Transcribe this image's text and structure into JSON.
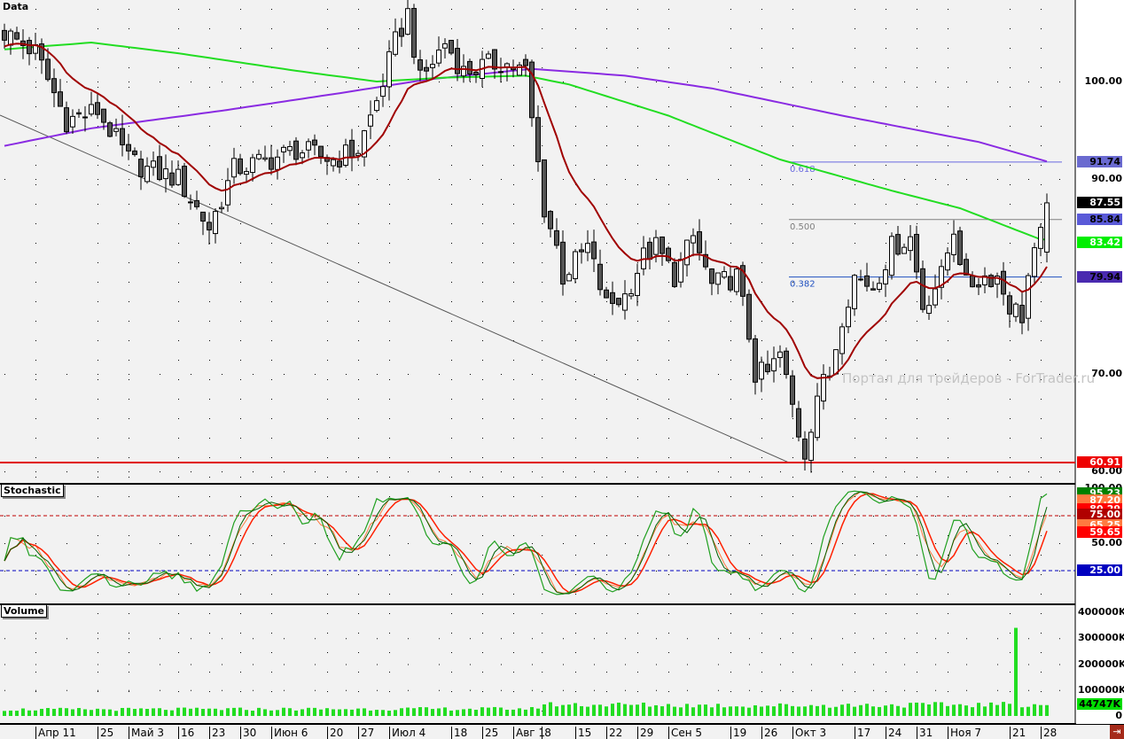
{
  "symbol_label": "Data",
  "panels": {
    "stochastic": "Stochastic",
    "volume": "Volume"
  },
  "watermark": "Портал для трейдеров - ForTrader.ru",
  "price_axis": {
    "min": 58,
    "max": 108,
    "ticks": [
      "100.00",
      "90.00",
      "70.00",
      "60.00"
    ],
    "tick_values": [
      100,
      90,
      70,
      60
    ]
  },
  "price_tags": [
    {
      "label": "91.74",
      "value": 91.74,
      "bg": "#6a6ad0",
      "fg": "#000"
    },
    {
      "label": "87.55",
      "value": 87.55,
      "bg": "#000000",
      "fg": "#fff"
    },
    {
      "label": "85.84",
      "value": 85.84,
      "bg": "#5a5ad8",
      "fg": "#000"
    },
    {
      "label": "83.42",
      "value": 83.42,
      "bg": "#00ee00",
      "fg": "#fff"
    },
    {
      "label": "79.94",
      "value": 79.94,
      "bg": "#4a2ab0",
      "fg": "#000"
    },
    {
      "label": "60.91",
      "value": 60.91,
      "bg": "#ee0000",
      "fg": "#fff"
    }
  ],
  "fibonacci": [
    {
      "label": "0.618",
      "value": 91.74,
      "color": "#6a6ae0"
    },
    {
      "label": "0.500",
      "value": 85.84,
      "color": "#808080"
    },
    {
      "label": "0.382",
      "value": 79.94,
      "color": "#2050c0"
    }
  ],
  "support_level": 60.91,
  "stoch_axis": {
    "ticks": [
      "100.00",
      "50.00"
    ],
    "tick_values": [
      100,
      50
    ]
  },
  "stoch_tags": [
    {
      "label": "95.23",
      "value": 95.23,
      "bg": "#008000",
      "fg": "#fff"
    },
    {
      "label": "87.20",
      "value": 88.5,
      "bg": "#ff7a40",
      "fg": "#fff"
    },
    {
      "label": "80.29",
      "value": 80.29,
      "bg": "#ff0000",
      "fg": "#fff"
    },
    {
      "label": "75.00",
      "value": 75.5,
      "bg": "#b00000",
      "fg": "#fff"
    },
    {
      "label": "65.25",
      "value": 65.8,
      "bg": "#ff7a40",
      "fg": "#fff"
    },
    {
      "label": "59.65",
      "value": 59.65,
      "bg": "#ff0000",
      "fg": "#fff"
    },
    {
      "label": "25.00",
      "value": 25,
      "bg": "#0000c0",
      "fg": "#fff"
    }
  ],
  "volume_axis": {
    "ticks": [
      "400000K",
      "300000K",
      "200000K",
      "100000K",
      "0"
    ],
    "tick_values": [
      400000,
      300000,
      200000,
      100000,
      0
    ]
  },
  "volume_tag": {
    "label": "44747K",
    "value": 44747,
    "bg": "#00dd00",
    "fg": "#000"
  },
  "dates": [
    {
      "label": "Апр 11",
      "day": 5
    },
    {
      "label": "25",
      "day": 15
    },
    {
      "label": "Май 3",
      "day": 20
    },
    {
      "label": "16",
      "day": 28
    },
    {
      "label": "23",
      "day": 33
    },
    {
      "label": "30",
      "day": 38
    },
    {
      "label": "Июн 6",
      "day": 43
    },
    {
      "label": "20",
      "day": 52
    },
    {
      "label": "27",
      "day": 57
    },
    {
      "label": "Июл 4",
      "day": 62
    },
    {
      "label": "18",
      "day": 72
    },
    {
      "label": "25",
      "day": 77
    },
    {
      "label": "Авг 1",
      "day": 82
    },
    {
      "label": "8",
      "day": 86.6
    },
    {
      "label": "15",
      "day": 92
    },
    {
      "label": "22",
      "day": 97
    },
    {
      "label": "29",
      "day": 102
    },
    {
      "label": "Сен 5",
      "day": 107
    },
    {
      "label": "19",
      "day": 117
    },
    {
      "label": "26",
      "day": 122
    },
    {
      "label": "Окт 3",
      "day": 127
    },
    {
      "label": "17",
      "day": 137
    },
    {
      "label": "24",
      "day": 142
    },
    {
      "label": "31",
      "day": 147
    },
    {
      "label": "Ноя 7",
      "day": 152
    },
    {
      "label": "21",
      "day": 162
    },
    {
      "label": "28",
      "day": 167
    }
  ],
  "chart_data": {
    "type": "candlestick",
    "bars": 169,
    "close_path": [
      [
        0,
        105
      ],
      [
        5,
        103
      ],
      [
        10,
        96
      ],
      [
        15,
        97
      ],
      [
        20,
        92
      ],
      [
        23,
        91
      ],
      [
        28,
        90
      ],
      [
        33,
        85
      ],
      [
        37,
        91
      ],
      [
        43,
        92
      ],
      [
        47,
        93
      ],
      [
        53,
        92
      ],
      [
        57,
        93
      ],
      [
        60,
        98
      ],
      [
        63,
        104
      ],
      [
        65,
        107
      ],
      [
        67,
        100
      ],
      [
        71,
        104
      ],
      [
        74,
        101
      ],
      [
        80,
        102
      ],
      [
        84,
        101
      ],
      [
        85,
        96
      ],
      [
        87,
        87
      ],
      [
        89,
        83
      ],
      [
        90,
        80
      ],
      [
        94,
        83
      ],
      [
        97,
        77
      ],
      [
        100,
        78
      ],
      [
        103,
        82
      ],
      [
        105,
        83
      ],
      [
        108,
        80
      ],
      [
        111,
        84
      ],
      [
        114,
        79
      ],
      [
        118,
        80
      ],
      [
        120,
        74
      ],
      [
        121,
        70
      ],
      [
        123,
        70
      ],
      [
        125,
        72
      ],
      [
        128,
        64
      ],
      [
        129,
        62
      ],
      [
        131,
        68
      ],
      [
        133,
        70
      ],
      [
        135,
        76
      ],
      [
        137,
        80
      ],
      [
        140,
        79
      ],
      [
        143,
        83
      ],
      [
        146,
        84
      ],
      [
        148,
        77
      ],
      [
        151,
        80
      ],
      [
        153,
        85
      ],
      [
        155,
        79
      ],
      [
        158,
        80
      ],
      [
        160,
        80
      ],
      [
        162,
        77
      ],
      [
        164,
        76
      ],
      [
        165,
        80
      ],
      [
        167,
        84
      ],
      [
        168,
        87.55
      ]
    ],
    "ma_short_period": 14,
    "ma_mid_path": [
      [
        0,
        103.3
      ],
      [
        14,
        104.0
      ],
      [
        28,
        102.9
      ],
      [
        47,
        101.1
      ],
      [
        60,
        100
      ],
      [
        71,
        100.4
      ],
      [
        84,
        100.6
      ],
      [
        91,
        99.7
      ],
      [
        107,
        96.5
      ],
      [
        125,
        92
      ],
      [
        143,
        88.8
      ],
      [
        154,
        87
      ],
      [
        167,
        83.8
      ]
    ],
    "ma_long_path": [
      [
        0,
        93.4
      ],
      [
        14,
        95.2
      ],
      [
        35,
        97
      ],
      [
        54,
        98.8
      ],
      [
        68,
        100.2
      ],
      [
        85,
        101.3
      ],
      [
        100,
        100.6
      ],
      [
        114,
        99.3
      ],
      [
        135,
        96.5
      ],
      [
        157,
        93.8
      ],
      [
        168,
        91.8
      ]
    ],
    "volume_path": [
      [
        0,
        25000
      ],
      [
        85,
        28000
      ],
      [
        87,
        45000
      ],
      [
        120,
        40000
      ],
      [
        168,
        44747
      ]
    ],
    "volume_spike": {
      "day": 163,
      "value": 340000
    },
    "colors": {
      "ma_short": "#a00000",
      "ma_mid": "#22dd22",
      "ma_long": "#8a2be2"
    }
  }
}
